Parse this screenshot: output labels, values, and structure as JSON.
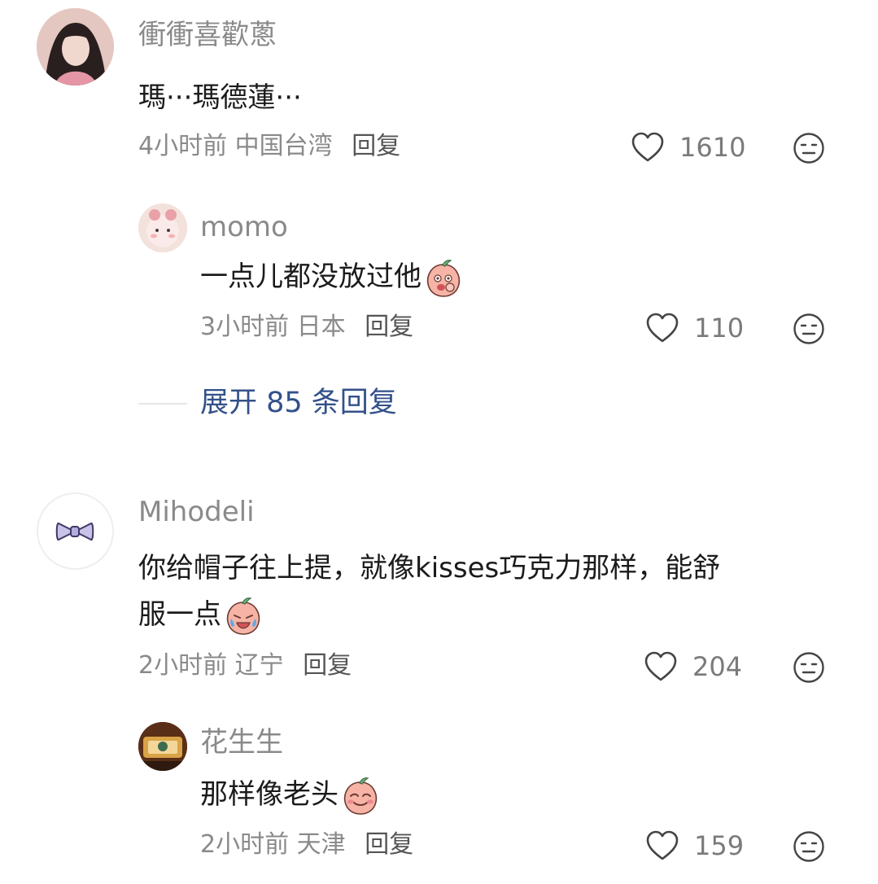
{
  "comments": [
    {
      "user": "衝衝喜歡蔥",
      "text": "瑪···瑪德蓮···",
      "time": "4小时前",
      "location": "中国台湾",
      "reply": "回复",
      "likes": "1610",
      "replies": [
        {
          "user": "momo",
          "text": "一点儿都没放过他",
          "time": "3小时前",
          "location": "日本",
          "reply": "回复",
          "likes": "110"
        }
      ],
      "expand_label": "展开 85 条回复"
    },
    {
      "user": "Mihodeli",
      "text_line1": "你给帽子往上提，就像kisses巧克力那样，能舒",
      "text_line2": "服一点",
      "time": "2小时前",
      "location": "辽宁",
      "reply": "回复",
      "likes": "204",
      "replies": [
        {
          "user": "花生生",
          "text": "那样像老头",
          "time": "2小时前",
          "location": "天津",
          "reply": "回复",
          "likes": "159"
        }
      ]
    }
  ],
  "icons": {
    "like": "heart-outline-icon",
    "dislike": "neutral-face-icon",
    "emoji": "peach-sticker"
  },
  "colors": {
    "username": "#8a8a8a",
    "text": "#1b1b1b",
    "link": "#33508a"
  }
}
